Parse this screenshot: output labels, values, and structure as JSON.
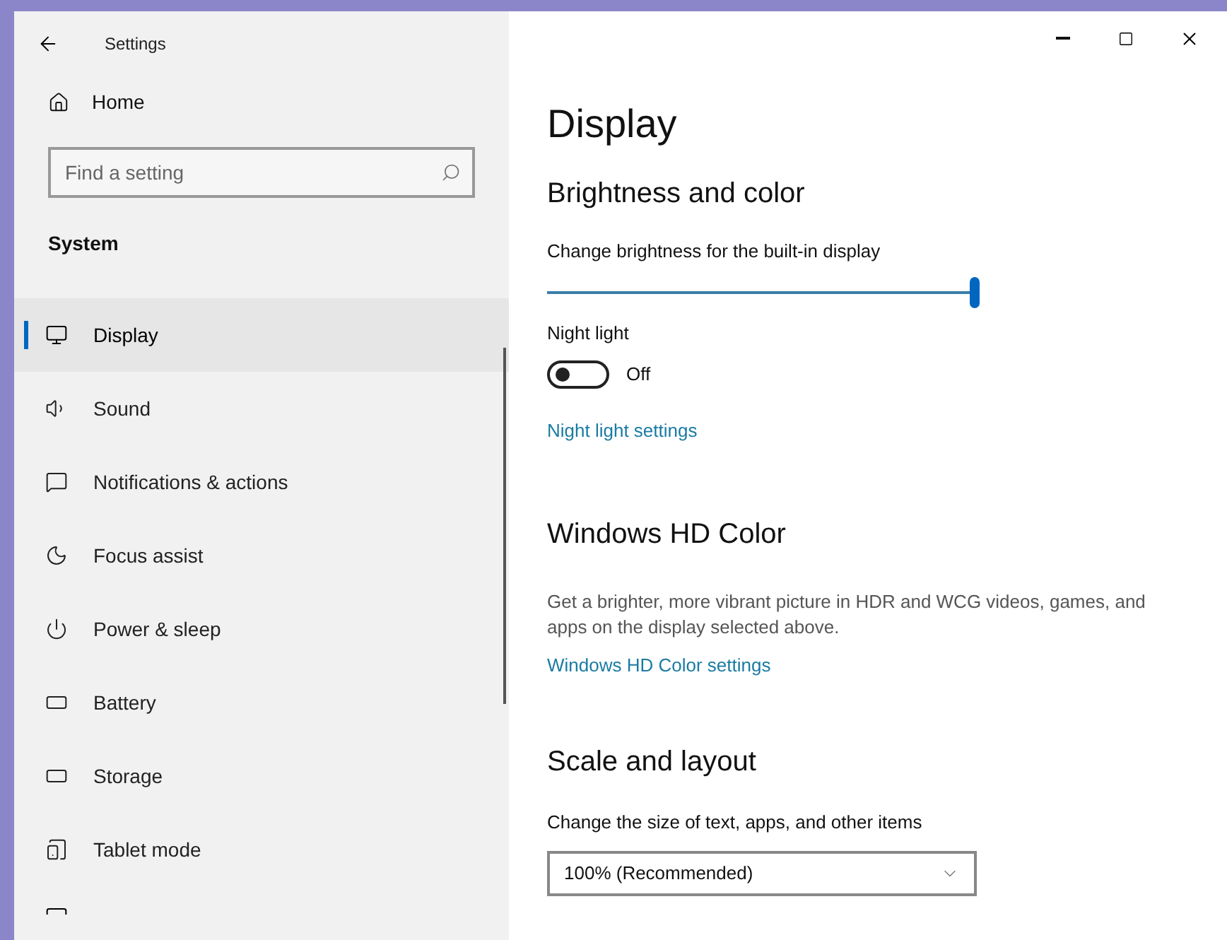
{
  "window": {
    "title": "Settings"
  },
  "sidebar": {
    "home": "Home",
    "search": {
      "placeholder": "Find a setting"
    },
    "section": "System",
    "items": [
      {
        "label": "Display",
        "selected": true
      },
      {
        "label": "Sound",
        "selected": false
      },
      {
        "label": "Notifications & actions",
        "selected": false
      },
      {
        "label": "Focus assist",
        "selected": false
      },
      {
        "label": "Power & sleep",
        "selected": false
      },
      {
        "label": "Battery",
        "selected": false
      },
      {
        "label": "Storage",
        "selected": false
      },
      {
        "label": "Tablet mode",
        "selected": false
      }
    ]
  },
  "page": {
    "title": "Display",
    "brightness": {
      "heading": "Brightness and color",
      "label": "Change brightness for the built-in display",
      "level": 1
    },
    "night_light": {
      "label": "Night light",
      "on": false,
      "state": "Off",
      "link": "Night light settings"
    },
    "hd_color": {
      "heading": "Windows HD Color",
      "description": "Get a brighter, more vibrant picture in HDR and WCG videos, games, and apps on the display selected above.",
      "link": "Windows HD Color settings"
    },
    "scale": {
      "heading": "Scale and layout",
      "label": "Change the size of text, apps, and other items",
      "value": "100% (Recommended)"
    }
  }
}
